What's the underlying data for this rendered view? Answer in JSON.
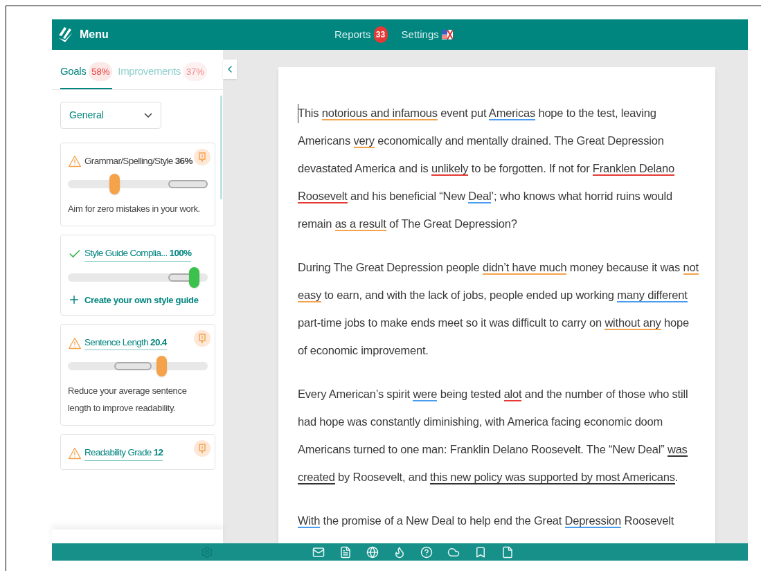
{
  "header": {
    "menu": "Menu",
    "reports": {
      "label": "Reports",
      "count": "33"
    },
    "settings": "Settings"
  },
  "tabs": [
    {
      "label": "Goals",
      "value": "58%",
      "selected": true
    },
    {
      "label": "Improvements",
      "value": "37%",
      "selected": false
    }
  ],
  "filter": {
    "value": "General"
  },
  "goals": [
    {
      "kind": "warning",
      "title": "Grammar/Spelling/Style",
      "value": "36%",
      "linked": false,
      "level": 0.33,
      "target": {
        "kind": "high"
      },
      "note": "Aim for zero mistakes in your work."
    },
    {
      "kind": "ok",
      "title": "Style Guide Complia...",
      "value": "100%",
      "linked": true,
      "level": 0.9,
      "target": {
        "kind": "upper"
      },
      "link": "Create your own style guide"
    },
    {
      "kind": "warning",
      "title": "Sentence Length",
      "value": "20.4",
      "linked": true,
      "level": 0.67,
      "target": {
        "kind": "middle"
      },
      "note": "Reduce your average sentence length to improve readability."
    },
    {
      "kind": "warning",
      "title": "Readability Grade",
      "value": "12",
      "linked": true
    }
  ],
  "document": {
    "paragraphs": [
      {
        "segments": [
          {
            "text": "This "
          },
          {
            "text": "notorious and infamous",
            "color": "#f5a34a"
          },
          {
            "text": " event put "
          },
          {
            "text": "Americas",
            "color": "#4a9cf0"
          },
          {
            "text": " hope to the test, leaving Americans "
          },
          {
            "text": "very",
            "color": "#f5a34a"
          },
          {
            "text": " economically and mentally drained. The Great Depression devastated America and is "
          },
          {
            "text": "unlikely",
            "color": "#e53935"
          },
          {
            "text": " to be forgotten. If not for "
          },
          {
            "text": "Franklen Delano Roosevelt",
            "color": "#e53935"
          },
          {
            "text": " and his beneficial “New "
          },
          {
            "text": "Deal",
            "color": "#4a9cf0"
          },
          {
            "text": "’; who knows what horrid ruins would remain "
          },
          {
            "text": "as a result",
            "color": "#f5a34a"
          },
          {
            "text": " of The Great Depression?"
          }
        ]
      },
      {
        "segments": [
          {
            "text": "During The Great Depression people "
          },
          {
            "text": "didn’t have much",
            "color": "#f5a34a"
          },
          {
            "text": " money because it was "
          },
          {
            "text": "not easy",
            "color": "#f5a34a"
          },
          {
            "text": " to earn, and with the lack of jobs, people ended up working "
          },
          {
            "text": "many different",
            "color": "#4a9cf0"
          },
          {
            "text": " part-time jobs to make ends meet so it was difficult to carry on "
          },
          {
            "text": "without any",
            "color": "#f5a34a"
          },
          {
            "text": " hope of economic improvement."
          }
        ]
      },
      {
        "segments": [
          {
            "text": "Every American’s spirit "
          },
          {
            "text": "were",
            "color": "#4a9cf0"
          },
          {
            "text": " being tested "
          },
          {
            "text": "alot",
            "color": "#e53935"
          },
          {
            "text": " and the number of those who still had hope was constantly diminishing, with America facing economic doom Americans turned to one man: Franklin Delano Roosevelt. The “New Deal” "
          },
          {
            "text": "was created",
            "color": "#333333"
          },
          {
            "text": " by Roosevelt, and "
          },
          {
            "text": "this new policy was supported by most Americans",
            "color": "#333333"
          },
          {
            "text": "."
          }
        ]
      },
      {
        "segments": [
          {
            "text": "With",
            "color": "#4a9cf0"
          },
          {
            "text": " the promise of a New Deal to help end the Great "
          },
          {
            "text": "Depression",
            "color": "#4a9cf0"
          },
          {
            "text": " Roosevelt"
          }
        ]
      }
    ]
  }
}
